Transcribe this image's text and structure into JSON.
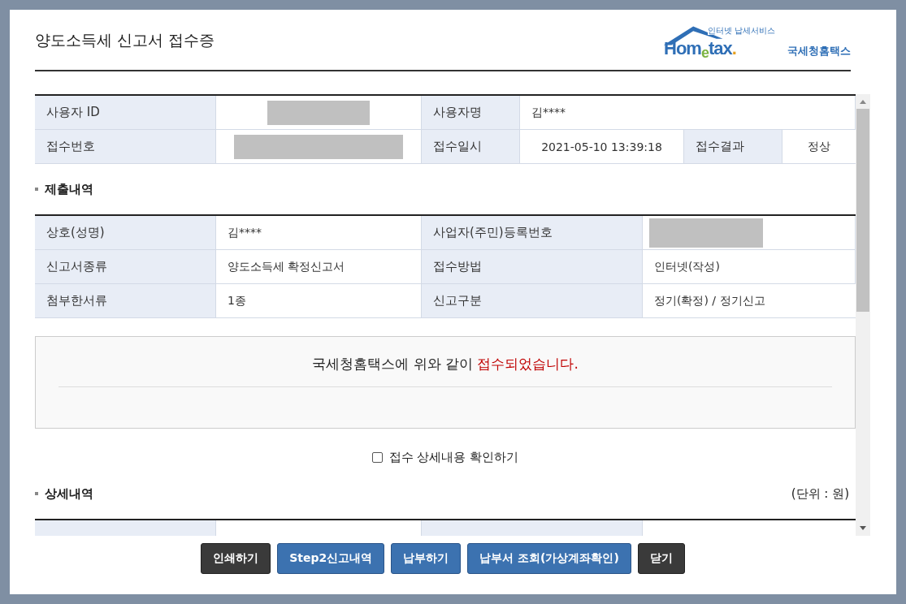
{
  "window": {
    "title": "양도소득세 신고서 접수증"
  },
  "logo": {
    "tagline": "인터넷 납세서비스",
    "brand_left": "Hom",
    "brand_e": "e",
    "brand_right": "tax",
    "dot": ".",
    "name": "국세청홈택스"
  },
  "user_table": {
    "rows": [
      [
        {
          "label": "사용자 ID",
          "redacted": true
        },
        {
          "label": "사용자명",
          "value": "김****"
        }
      ],
      [
        {
          "label": "접수번호",
          "redacted": true
        },
        {
          "label": "접수일시",
          "value": "2021-05-10 13:39:18"
        },
        {
          "label": "접수결과",
          "value": "정상"
        }
      ]
    ]
  },
  "submission": {
    "heading": "제출내역",
    "rows": [
      [
        {
          "label": "상호(성명)",
          "value": "김****"
        },
        {
          "label": "사업자(주민)등록번호",
          "redacted": true
        }
      ],
      [
        {
          "label": "신고서종류",
          "value": "양도소득세 확정신고서"
        },
        {
          "label": "접수방법",
          "value": "인터넷(작성)"
        }
      ],
      [
        {
          "label": "첨부한서류",
          "value": "1종"
        },
        {
          "label": "신고구분",
          "value": "정기(확정) / 정기신고"
        }
      ]
    ]
  },
  "message": "국세청홈택스에 위와 같이 **접수되었습니다.**",
  "detail_checkbox": {
    "label": "접수 상세내용 확인하기",
    "checked": false
  },
  "details": {
    "heading": "상세내역",
    "unit": "(단위 : 원)"
  },
  "buttons": [
    {
      "label": "인쇄하기",
      "kind": "dark"
    },
    {
      "label": "Step2신고내역",
      "kind": "blue"
    },
    {
      "label": "납부하기",
      "kind": "blue"
    },
    {
      "label": "납부서 조회(가상계좌확인)",
      "kind": "blue"
    },
    {
      "label": "닫기",
      "kind": "dark"
    }
  ]
}
